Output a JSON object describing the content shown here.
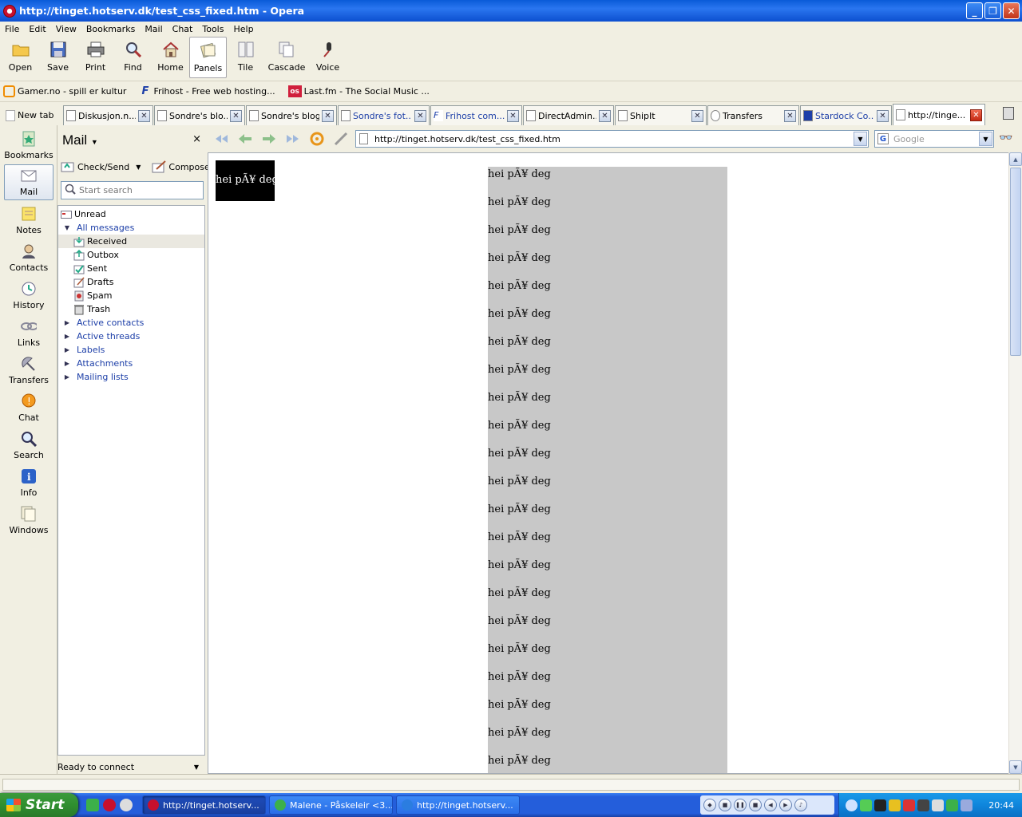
{
  "window": {
    "title": "http://tinget.hotserv.dk/test_css_fixed.htm - Opera",
    "min_label": "_",
    "max_label": "❐",
    "close_label": "✕"
  },
  "menu": [
    "File",
    "Edit",
    "View",
    "Bookmarks",
    "Mail",
    "Chat",
    "Tools",
    "Help"
  ],
  "toolbar": {
    "buttons": [
      {
        "label": "Open",
        "icon": "folder-icon"
      },
      {
        "label": "Save",
        "icon": "floppy-icon"
      },
      {
        "label": "Print",
        "icon": "printer-icon"
      },
      {
        "label": "Find",
        "icon": "magnifier-icon"
      },
      {
        "label": "Home",
        "icon": "house-icon"
      },
      {
        "label": "Panels",
        "icon": "panels-icon"
      },
      {
        "label": "Tile",
        "icon": "tile-icon"
      },
      {
        "label": "Cascade",
        "icon": "cascade-icon"
      },
      {
        "label": "Voice",
        "icon": "microphone-icon"
      }
    ]
  },
  "bookmarks_bar": [
    {
      "label": "Gamer.no - spill er kultur",
      "icon": "gamer-icon",
      "color": "#f08c00"
    },
    {
      "label": "Frihost - Free web hosting...",
      "icon": "frihost-icon",
      "color": "#1d3fa8"
    },
    {
      "label": "Last.fm - The Social Music ...",
      "icon": "lastfm-icon",
      "color": "#d01f3c"
    }
  ],
  "tabs": {
    "new_tab_label": "New tab",
    "items": [
      {
        "label": "Diskusjon.n...",
        "blue": false
      },
      {
        "label": "Sondre's blo...",
        "blue": false
      },
      {
        "label": "Sondre's blogg",
        "blue": false
      },
      {
        "label": "Sondre's fot...",
        "blue": true
      },
      {
        "label": "Frihost com...",
        "blue": true
      },
      {
        "label": "DirectAdmin...",
        "blue": false
      },
      {
        "label": "ShipIt",
        "blue": false
      },
      {
        "label": "Transfers",
        "blue": false
      },
      {
        "label": "Stardock Co...",
        "blue": true
      },
      {
        "label": "http://tinge...",
        "blue": false
      }
    ],
    "close_glyph": "✕"
  },
  "panel_selector": [
    {
      "label": "Bookmarks",
      "icon": "bookmarks-icon"
    },
    {
      "label": "Mail",
      "icon": "mail-icon"
    },
    {
      "label": "Notes",
      "icon": "notes-icon"
    },
    {
      "label": "Contacts",
      "icon": "contacts-icon"
    },
    {
      "label": "History",
      "icon": "history-icon"
    },
    {
      "label": "Links",
      "icon": "links-icon"
    },
    {
      "label": "Transfers",
      "icon": "transfers-icon"
    },
    {
      "label": "Chat",
      "icon": "chat-icon"
    },
    {
      "label": "Search",
      "icon": "search-icon"
    },
    {
      "label": "Info",
      "icon": "info-icon"
    },
    {
      "label": "Windows",
      "icon": "windows-icon"
    }
  ],
  "mail": {
    "title": "Mail",
    "close_glyph": "×",
    "check_send": "Check/Send",
    "compose": "Compose",
    "search_placeholder": "Start search",
    "folders": [
      {
        "label": "Unread",
        "level": 0,
        "type": "item",
        "icon": "unread-icon"
      },
      {
        "label": "All messages",
        "level": 0,
        "type": "open-group"
      },
      {
        "label": "Received",
        "level": 1,
        "type": "item",
        "icon": "received-icon",
        "selected": true
      },
      {
        "label": "Outbox",
        "level": 1,
        "type": "item",
        "icon": "outbox-icon"
      },
      {
        "label": "Sent",
        "level": 1,
        "type": "item",
        "icon": "sent-icon"
      },
      {
        "label": "Drafts",
        "level": 1,
        "type": "item",
        "icon": "drafts-icon"
      },
      {
        "label": "Spam",
        "level": 1,
        "type": "item",
        "icon": "spam-icon"
      },
      {
        "label": "Trash",
        "level": 1,
        "type": "item",
        "icon": "trash-icon"
      },
      {
        "label": "Active contacts",
        "level": 0,
        "type": "group"
      },
      {
        "label": "Active threads",
        "level": 0,
        "type": "group"
      },
      {
        "label": "Labels",
        "level": 0,
        "type": "group"
      },
      {
        "label": "Attachments",
        "level": 0,
        "type": "group"
      },
      {
        "label": "Mailing lists",
        "level": 0,
        "type": "group"
      }
    ],
    "status": "Ready to connect"
  },
  "address_bar": {
    "url": "http://tinget.hotserv.dk/test_css_fixed.htm",
    "search_engine": "Google"
  },
  "page": {
    "fixed_box_text": "hei pÃ¥ deg",
    "column_lines": [
      "hei pÃ¥ deg",
      "hei pÃ¥ deg",
      "hei pÃ¥ deg",
      "hei pÃ¥ deg",
      "hei pÃ¥ deg",
      "hei pÃ¥ deg",
      "hei pÃ¥ deg",
      "hei pÃ¥ deg",
      "hei pÃ¥ deg",
      "hei pÃ¥ deg",
      "hei pÃ¥ deg",
      "hei pÃ¥ deg",
      "hei pÃ¥ deg",
      "hei pÃ¥ deg",
      "hei pÃ¥ deg",
      "hei pÃ¥ deg",
      "hei pÃ¥ deg",
      "hei pÃ¥ deg",
      "hei pÃ¥ deg",
      "hei pÃ¥ deg",
      "hei pÃ¥ deg",
      "hei pÃ¥ deg"
    ]
  },
  "taskbar": {
    "start_label": "Start",
    "tasks": [
      {
        "label": "http://tinget.hotserv...",
        "active": true,
        "icon": "opera-icon"
      },
      {
        "label": "Malene - Påskeleir <3...",
        "active": false,
        "icon": "msn-icon"
      },
      {
        "label": "http://tinget.hotserv...",
        "active": false,
        "icon": "ie-icon"
      }
    ],
    "clock": "20:44"
  }
}
